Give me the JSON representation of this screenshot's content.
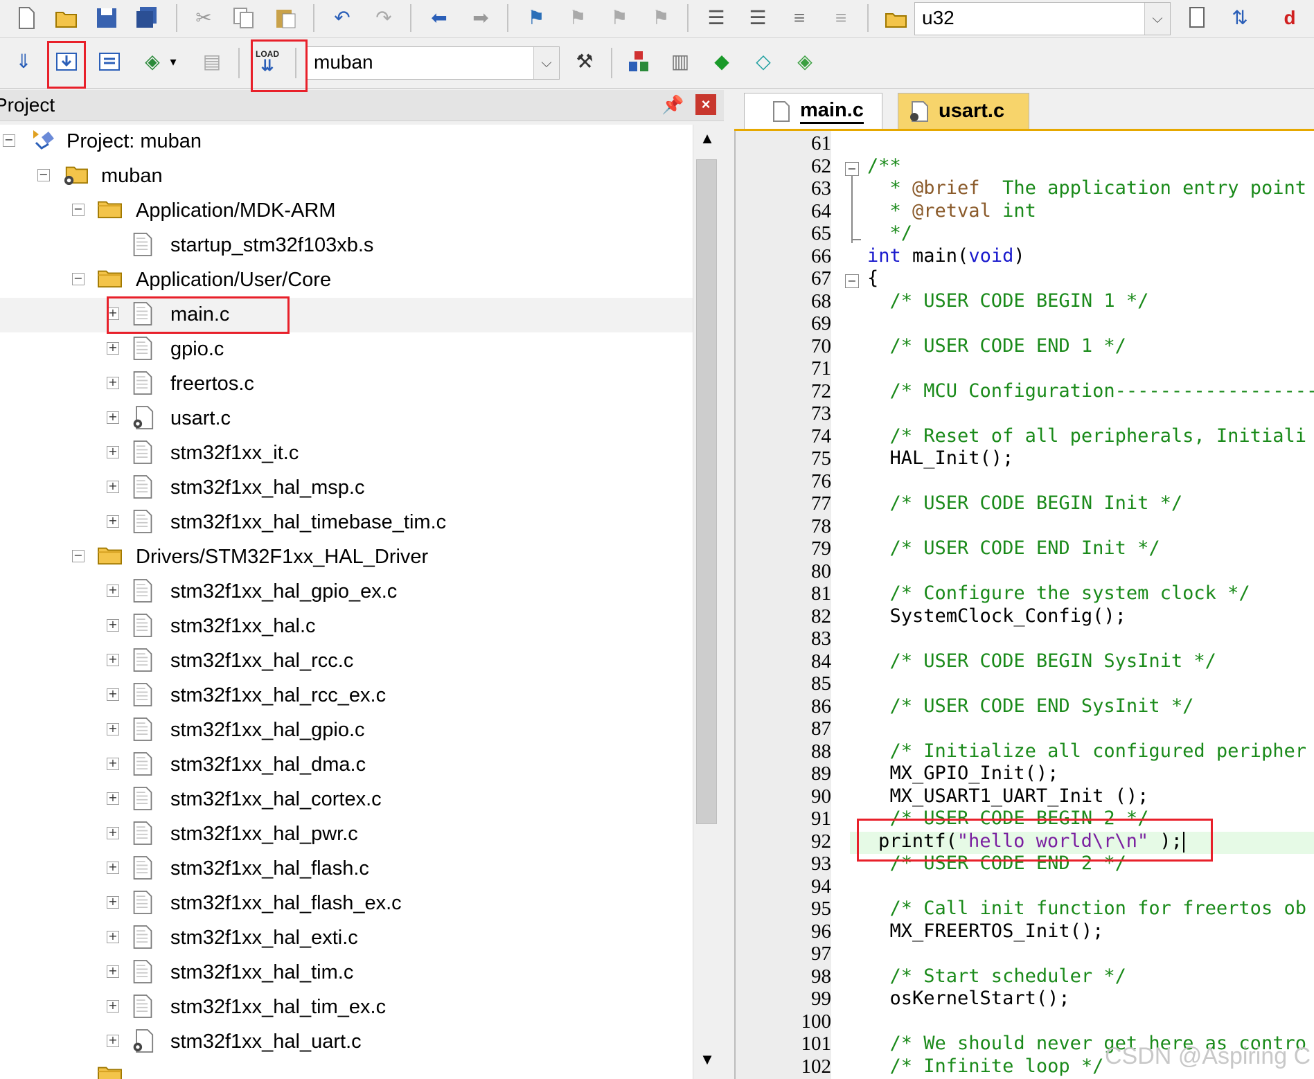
{
  "toolbar_top": {
    "target_combo_value": "u32"
  },
  "toolbar_build": {
    "project_combo_value": "muban",
    "load_label": "LOAD"
  },
  "project_panel": {
    "title": "Project",
    "tree": {
      "root": "Project: muban",
      "target": "muban",
      "groups": [
        {
          "name": "Application/MDK-ARM",
          "files": [
            "startup_stm32f103xb.s"
          ]
        },
        {
          "name": "Application/User/Core",
          "files": [
            "main.c",
            "gpio.c",
            "freertos.c",
            "usart.c",
            "stm32f1xx_it.c",
            "stm32f1xx_hal_msp.c",
            "stm32f1xx_hal_timebase_tim.c"
          ]
        },
        {
          "name": "Drivers/STM32F1xx_HAL_Driver",
          "files": [
            "stm32f1xx_hal_gpio_ex.c",
            "stm32f1xx_hal.c",
            "stm32f1xx_hal_rcc.c",
            "stm32f1xx_hal_rcc_ex.c",
            "stm32f1xx_hal_gpio.c",
            "stm32f1xx_hal_dma.c",
            "stm32f1xx_hal_cortex.c",
            "stm32f1xx_hal_pwr.c",
            "stm32f1xx_hal_flash.c",
            "stm32f1xx_hal_flash_ex.c",
            "stm32f1xx_hal_exti.c",
            "stm32f1xx_hal_tim.c",
            "stm32f1xx_hal_tim_ex.c",
            "stm32f1xx_hal_uart.c"
          ]
        }
      ]
    }
  },
  "editor": {
    "tabs": [
      "main.c",
      "usart.c"
    ],
    "active_tab": "main.c",
    "lines": [
      {
        "n": "61",
        "t": ""
      },
      {
        "n": "62",
        "t": "/**"
      },
      {
        "n": "63",
        "t": "  * @brief  The application entry point"
      },
      {
        "n": "64",
        "t": "  * @retval int"
      },
      {
        "n": "65",
        "t": "  */"
      },
      {
        "n": "66",
        "t": "int main(void)"
      },
      {
        "n": "67",
        "t": "{"
      },
      {
        "n": "68",
        "t": "  /* USER CODE BEGIN 1 */"
      },
      {
        "n": "69",
        "t": ""
      },
      {
        "n": "70",
        "t": "  /* USER CODE END 1 */"
      },
      {
        "n": "71",
        "t": ""
      },
      {
        "n": "72",
        "t": "  /* MCU Configuration------------------"
      },
      {
        "n": "73",
        "t": ""
      },
      {
        "n": "74",
        "t": "  /* Reset of all peripherals, Initiali"
      },
      {
        "n": "75",
        "t": "  HAL_Init();"
      },
      {
        "n": "76",
        "t": ""
      },
      {
        "n": "77",
        "t": "  /* USER CODE BEGIN Init */"
      },
      {
        "n": "78",
        "t": ""
      },
      {
        "n": "79",
        "t": "  /* USER CODE END Init */"
      },
      {
        "n": "80",
        "t": ""
      },
      {
        "n": "81",
        "t": "  /* Configure the system clock */"
      },
      {
        "n": "82",
        "t": "  SystemClock_Config();"
      },
      {
        "n": "83",
        "t": ""
      },
      {
        "n": "84",
        "t": "  /* USER CODE BEGIN SysInit */"
      },
      {
        "n": "85",
        "t": ""
      },
      {
        "n": "86",
        "t": "  /* USER CODE END SysInit */"
      },
      {
        "n": "87",
        "t": ""
      },
      {
        "n": "88",
        "t": "  /* Initialize all configured peripher"
      },
      {
        "n": "89",
        "t": "  MX_GPIO_Init();"
      },
      {
        "n": "90",
        "t": "  MX_USART1_UART_Init ();"
      },
      {
        "n": "91",
        "t": "  /* USER CODE BEGIN 2 */"
      },
      {
        "n": "92",
        "t": "printf(\"hello world\\r\\n\" );"
      },
      {
        "n": "93",
        "t": "  /* USER CODE END 2 */"
      },
      {
        "n": "94",
        "t": ""
      },
      {
        "n": "95",
        "t": "  /* Call init function for freertos ob"
      },
      {
        "n": "96",
        "t": "  MX_FREERTOS_Init();"
      },
      {
        "n": "97",
        "t": ""
      },
      {
        "n": "98",
        "t": "  /* Start scheduler */"
      },
      {
        "n": "99",
        "t": "  osKernelStart();"
      },
      {
        "n": "100",
        "t": ""
      },
      {
        "n": "101",
        "t": "  /* We should never get here as contro"
      },
      {
        "n": "102",
        "t": "  /* Infinite loop */"
      }
    ]
  },
  "watermark": "CSDN @Aspiring C",
  "colors": {
    "keyword": "#1a1acd",
    "comment": "#1a8a1a",
    "string": "#7a1fa0",
    "doc_tag": "#8a5a2a",
    "active_line": "#e6fae6",
    "annotation_red": "#e8202a",
    "usart_tab": "#f7d46b"
  }
}
